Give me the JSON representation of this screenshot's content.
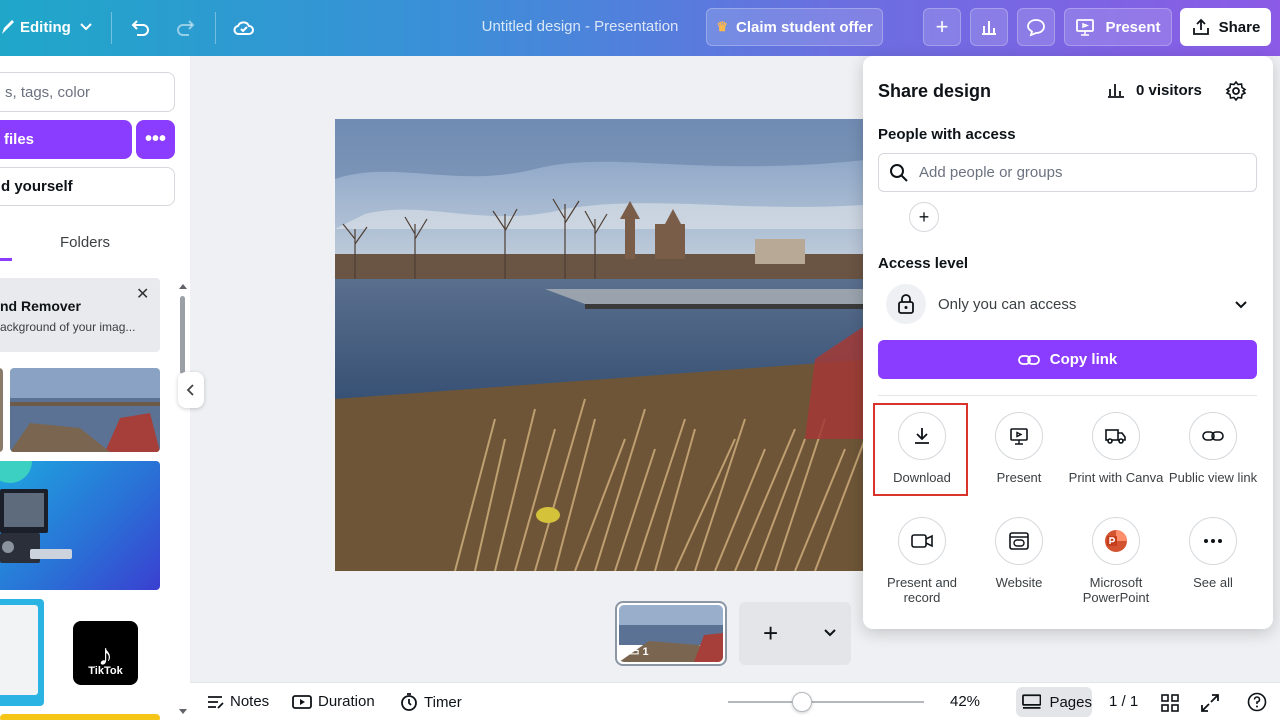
{
  "topbar": {
    "editing_label": "Editing",
    "title": "Untitled design - Presentation",
    "claim_label": "Claim student offer",
    "present_label": "Present",
    "share_label": "Share"
  },
  "left_panel": {
    "search_placeholder": "s, tags, color",
    "upload_label": "files",
    "record_label": "d yourself",
    "folders_tab": "Folders",
    "promo_title": "nd Remover",
    "promo_subtitle": "ackground of your imag...",
    "tiktok_label": "TikTok"
  },
  "share_panel": {
    "title": "Share design",
    "visitors": "0 visitors",
    "people_label": "People with access",
    "add_placeholder": "Add people or groups",
    "access_label": "Access level",
    "access_value": "Only you can access",
    "copy_link": "Copy link",
    "options": [
      {
        "label": "Download",
        "icon": "download-icon"
      },
      {
        "label": "Present",
        "icon": "present-icon"
      },
      {
        "label": "Print with Canva",
        "icon": "truck-icon"
      },
      {
        "label": "Public view link",
        "icon": "link-icon"
      },
      {
        "label": "Present and record",
        "icon": "video-icon"
      },
      {
        "label": "Website",
        "icon": "website-icon"
      },
      {
        "label": "Microsoft PowerPoint",
        "icon": "powerpoint-icon"
      },
      {
        "label": "See all",
        "icon": "more-icon"
      }
    ]
  },
  "pages": {
    "thumb_number": "1"
  },
  "bottom_bar": {
    "notes": "Notes",
    "duration": "Duration",
    "timer": "Timer",
    "zoom": "42%",
    "pages": "Pages",
    "page_count": "1 / 1"
  },
  "colors": {
    "accent": "#8b3dff",
    "highlight": "#d9332c"
  }
}
